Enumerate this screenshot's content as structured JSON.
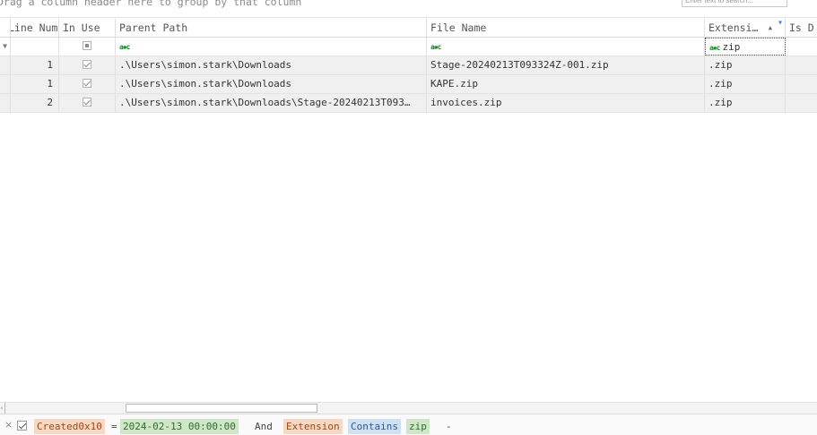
{
  "group_panel": {
    "hint": "Drag a column header here to group by that column",
    "search_placeholder": "Enter text to search..."
  },
  "columns": [
    {
      "label": "Line Number"
    },
    {
      "label": "In Use"
    },
    {
      "label": "Parent Path"
    },
    {
      "label": "File Name"
    },
    {
      "label": "Extensi…"
    },
    {
      "label": "Is D"
    }
  ],
  "filter_row": {
    "extension_filter": "zip",
    "filter_icon": "funnel-icon",
    "operator_icon": "contains-operator-icon"
  },
  "rows": [
    {
      "line_number": "1",
      "in_use": true,
      "parent_path": ".\\Users\\simon.stark\\Downloads",
      "file_name": "Stage-20240213T093324Z-001.zip",
      "extension": ".zip"
    },
    {
      "line_number": "1",
      "in_use": true,
      "parent_path": ".\\Users\\simon.stark\\Downloads",
      "file_name": "KAPE.zip",
      "extension": ".zip"
    },
    {
      "line_number": "2",
      "in_use": true,
      "parent_path": ".\\Users\\simon.stark\\Downloads\\Stage-20240213T093…",
      "file_name": "invoices.zip",
      "extension": ".zip"
    }
  ],
  "filter_bar": {
    "close": "×",
    "field1": "Created0x10",
    "op1": "=",
    "value1": "2024-02-13 00:00:00",
    "joiner": "And",
    "field2": "Extension",
    "op2": "Contains",
    "value2": "zip",
    "add": "-"
  },
  "colors": {
    "row_background": "#f0f0f0",
    "field_token": "#f6d8c4",
    "value_token": "#cfe6c8",
    "condition_token": "#cfe0f1",
    "filter_icon_green": "#1b8a2b",
    "sort_filter_blue": "#3a7bd5"
  }
}
